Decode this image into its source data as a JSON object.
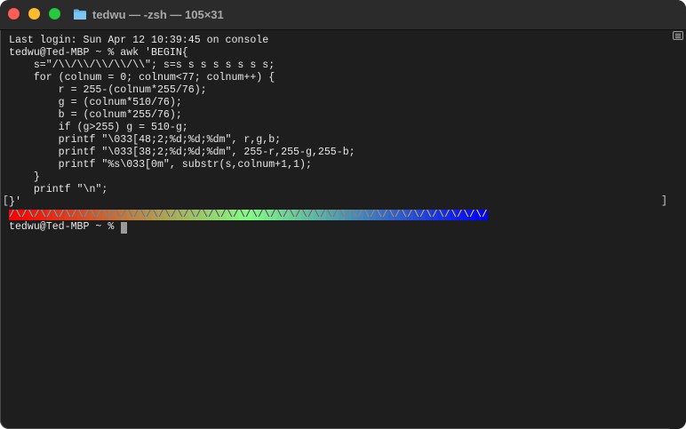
{
  "window": {
    "title": "tedwu — -zsh — 105×31"
  },
  "terminal": {
    "lines": [
      "Last login: Sun Apr 12 10:39:45 on console",
      "tedwu@Ted-MBP ~ % awk 'BEGIN{",
      "    s=\"/\\\\/\\\\/\\\\/\\\\/\\\\\"; s=s s s s s s s s;",
      "    for (colnum = 0; colnum<77; colnum++) {",
      "        r = 255-(colnum*255/76);",
      "        g = (colnum*510/76);",
      "        b = (colnum*255/76);",
      "        if (g>255) g = 510-g;",
      "        printf \"\\033[48;2;%d;%d;%dm\", r,g,b;",
      "        printf \"\\033[38;2;%d;%d;%dm\", 255-r,255-g,255-b;",
      "        printf \"%s\\033[0m\", substr(s,colnum+1,1);",
      "    }",
      "    printf \"\\n\";"
    ],
    "closing_line": "}'",
    "left_bracket": "[",
    "right_bracket": "]",
    "rainbow_text": "/\\/\\/\\/\\/\\/\\/\\/\\/\\/\\/\\/\\/\\/\\/\\/\\/\\/\\/\\/\\/\\/\\/\\/\\/\\/\\/\\/\\/\\/\\/\\/\\/\\/\\/\\/\\/\\/\\/",
    "prompt": "tedwu@Ted-MBP ~ % "
  },
  "colors": {
    "background": "#1e1e1e",
    "foreground": "#e8e8e8",
    "cursor": "#9a9a9a",
    "close": "#ff5f57",
    "minimize": "#febc2e",
    "maximize": "#28c840",
    "folder": "#5fb3e8"
  },
  "icons": {
    "title_icon": "folder-icon",
    "menu_icon": "list-icon"
  }
}
